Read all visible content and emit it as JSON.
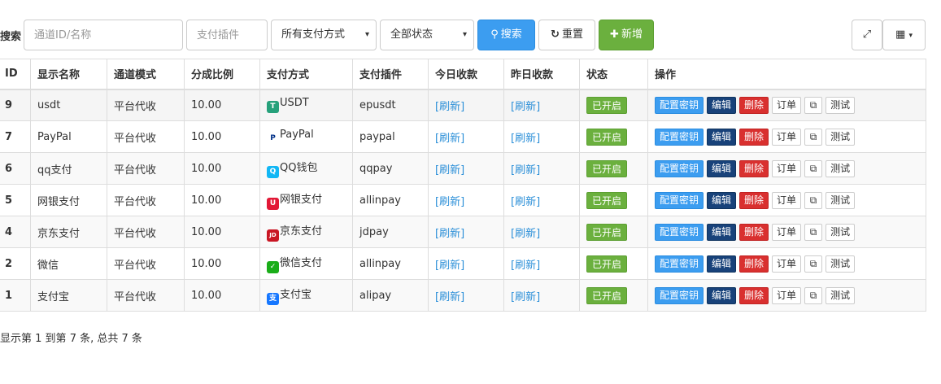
{
  "toolbar": {
    "search_label": "搜索",
    "channel_placeholder": "通道ID/名称",
    "plugin_placeholder": "支付插件",
    "paytype_selected": "所有支付方式",
    "status_selected": "全部状态",
    "search_label_btn": "搜索",
    "reset_label": "重置",
    "add_label": "新增"
  },
  "table": {
    "headers": [
      "ID",
      "显示名称",
      "通道模式",
      "分成比例",
      "支付方式",
      "支付插件",
      "今日收款",
      "昨日收款",
      "状态",
      "操作"
    ],
    "rows": [
      {
        "id": "9",
        "name": "usdt",
        "mode": "平台代收",
        "rate": "10.00",
        "paytype": "USDT",
        "icon": "usdt-icon",
        "plugin": "epusdt",
        "today": "[刷新]",
        "yesterday": "[刷新]",
        "status": "已开启"
      },
      {
        "id": "7",
        "name": "PayPal",
        "mode": "平台代收",
        "rate": "10.00",
        "paytype": "PayPal",
        "icon": "paypal-icon",
        "plugin": "paypal",
        "today": "[刷新]",
        "yesterday": "[刷新]",
        "status": "已开启"
      },
      {
        "id": "6",
        "name": "qq支付",
        "mode": "平台代收",
        "rate": "10.00",
        "paytype": "QQ钱包",
        "icon": "qq-icon",
        "plugin": "qqpay",
        "today": "[刷新]",
        "yesterday": "[刷新]",
        "status": "已开启"
      },
      {
        "id": "5",
        "name": "网银支付",
        "mode": "平台代收",
        "rate": "10.00",
        "paytype": "网银支付",
        "icon": "unionpay-icon",
        "plugin": "allinpay",
        "today": "[刷新]",
        "yesterday": "[刷新]",
        "status": "已开启"
      },
      {
        "id": "4",
        "name": "京东支付",
        "mode": "平台代收",
        "rate": "10.00",
        "paytype": "京东支付",
        "icon": "jd-icon",
        "plugin": "jdpay",
        "today": "[刷新]",
        "yesterday": "[刷新]",
        "status": "已开启"
      },
      {
        "id": "2",
        "name": "微信",
        "mode": "平台代收",
        "rate": "10.00",
        "paytype": "微信支付",
        "icon": "wechat-icon",
        "plugin": "allinpay",
        "today": "[刷新]",
        "yesterday": "[刷新]",
        "status": "已开启"
      },
      {
        "id": "1",
        "name": "支付宝",
        "mode": "平台代收",
        "rate": "10.00",
        "paytype": "支付宝",
        "icon": "alipay-icon",
        "plugin": "alipay",
        "today": "[刷新]",
        "yesterday": "[刷新]",
        "status": "已开启"
      }
    ],
    "actions": {
      "key": "配置密钥",
      "edit": "编辑",
      "delete": "删除",
      "orders": "订单",
      "test": "测试"
    }
  },
  "pager": {
    "prefix": "显示第 ",
    "from": "1",
    "mid1": " 到第 ",
    "to": "7",
    "mid2": " 条, 总共 ",
    "total": "7",
    "suffix": " 条"
  },
  "colors": {
    "primary": "#3c9df0",
    "success": "#6bb03e",
    "danger": "#d9302f",
    "edit": "#18427a",
    "link": "#2b8fd8"
  }
}
